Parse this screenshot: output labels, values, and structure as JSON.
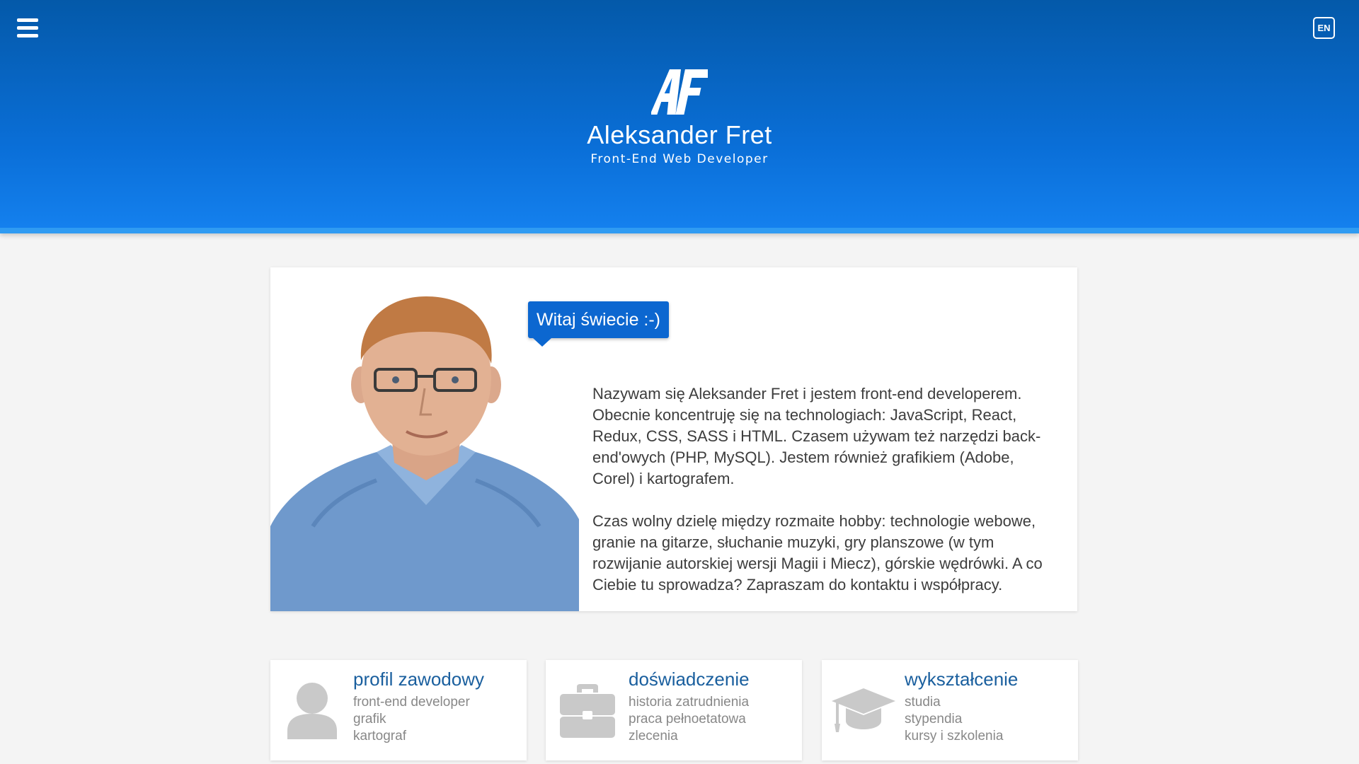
{
  "header": {
    "menu_icon": "hamburger-menu-icon",
    "lang_label": "EN",
    "logo_text": "AF",
    "name": "Aleksander Fret",
    "role": "Front-End Web Developer",
    "colors": {
      "top": "#0459a9",
      "bottom": "#1480ee",
      "accent_bar": "#2f9bf2"
    }
  },
  "intro": {
    "greeting": "Witaj świecie :-)",
    "paragraph_1": "Nazywam się Aleksander Fret i jestem front-end developerem. Obecnie koncentruję się na technologiach: JavaScript, React, Redux, CSS, SASS i HTML. Czasem używam też narzędzi back-end'owych (PHP, MySQL). Jestem również grafikiem (Adobe, Corel) i kartografem.",
    "paragraph_2": "Czas wolny dzielę między rozmaite hobby: technologie webowe, granie na gitarze, słuchanie muzyki, gry planszowe (w tym rozwijanie autorskiej wersji Magii i Miecz), górskie wędrówki. A co Ciebie tu sprowadza? Zapraszam do kontaktu i współpracy."
  },
  "features": [
    {
      "icon": "user-icon",
      "title": "profil zawodowy",
      "items": [
        "front-end developer",
        "grafik",
        "kartograf"
      ]
    },
    {
      "icon": "briefcase-icon",
      "title": "doświadczenie",
      "items": [
        "historia zatrudnienia",
        "praca pełnoetatowa",
        "zlecenia"
      ]
    },
    {
      "icon": "graduation-cap-icon",
      "title": "wykształcenie",
      "items": [
        "studia",
        "stypendia",
        "kursy i szkolenia"
      ]
    }
  ]
}
